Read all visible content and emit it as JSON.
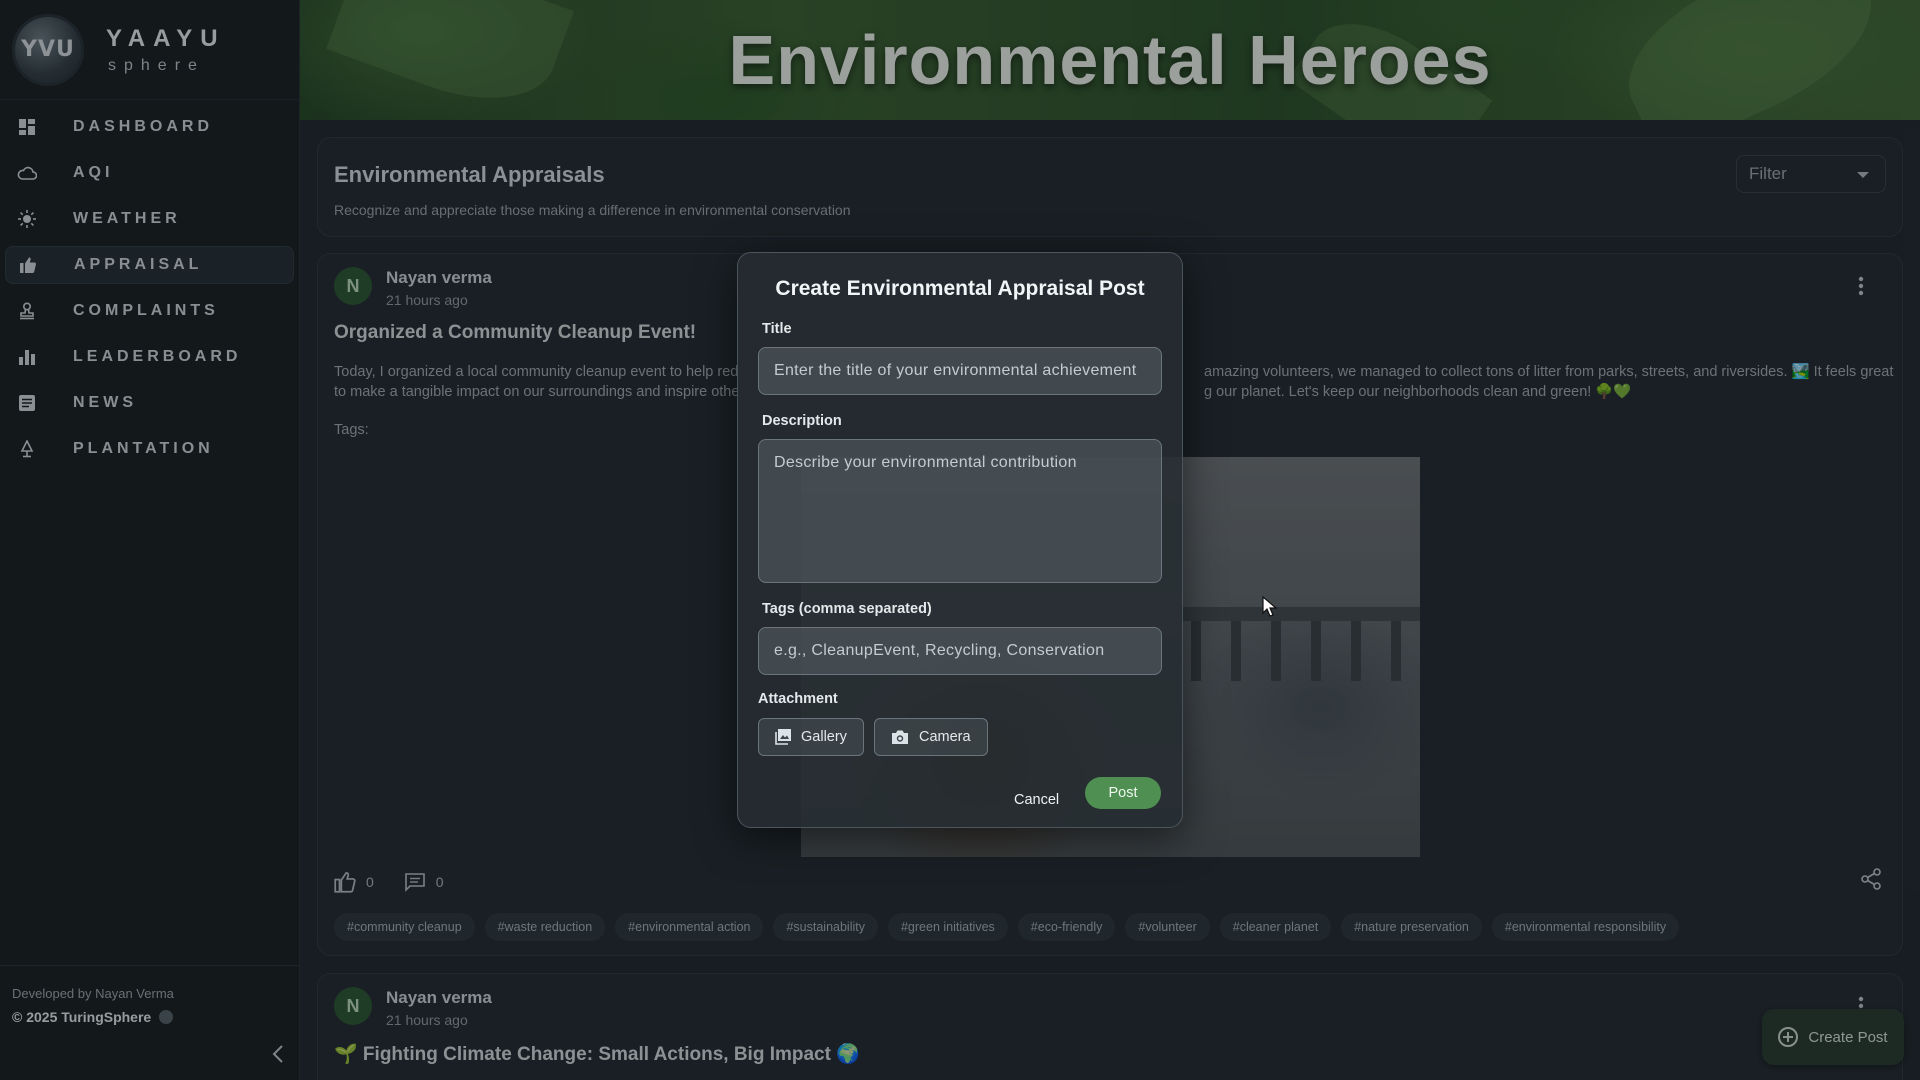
{
  "brand": {
    "logo_text": "YVU",
    "title": "YAAYU",
    "subtitle": "sphere"
  },
  "nav": [
    {
      "label": "DASHBOARD",
      "icon": "dashboard-icon"
    },
    {
      "label": "AQI",
      "icon": "cloud-icon"
    },
    {
      "label": "WEATHER",
      "icon": "sun-icon"
    },
    {
      "label": "APPRAISAL",
      "icon": "thumbs-up-icon",
      "active": true
    },
    {
      "label": "COMPLAINTS",
      "icon": "stamp-icon"
    },
    {
      "label": "LEADERBOARD",
      "icon": "bar-chart-icon"
    },
    {
      "label": "NEWS",
      "icon": "news-icon"
    },
    {
      "label": "PLANTATION",
      "icon": "plant-icon"
    }
  ],
  "footer": {
    "developed_by": "Developed by Nayan Verma",
    "copyright": "© 2025 TuringSphere"
  },
  "hero": {
    "title": "Environmental Heroes"
  },
  "appraisals": {
    "title": "Environmental Appraisals",
    "subtitle": "Recognize and appreciate those making a difference in environmental conservation",
    "filter_label": "Filter"
  },
  "post1": {
    "avatar_letter": "N",
    "author": "Nayan verma",
    "time": "21 hours ago",
    "title": "Organized a Community Cleanup Event!",
    "body_left": "Today, I organized a local community cleanup event to help red",
    "body_left2": "to make a tangible impact on our surroundings and inspire othe",
    "body_right": "amazing volunteers, we managed to collect tons of litter from parks, streets, and riversides. 🏞️ It feels great",
    "body_right2": "g our planet. Let's keep our neighborhoods clean and green! 🌳💚",
    "tags_label": "Tags:",
    "likes": "0",
    "comments": "0",
    "chips": [
      "#community cleanup",
      "#waste reduction",
      "#environmental action",
      "#sustainability",
      "#green initiatives",
      "#eco-friendly",
      "#volunteer",
      "#cleaner planet",
      "#nature preservation",
      "#environmental responsibility"
    ]
  },
  "post2": {
    "avatar_letter": "N",
    "author": "Nayan verma",
    "time": "21 hours ago",
    "title": "🌱 Fighting Climate Change: Small Actions, Big Impact 🌍"
  },
  "fab": {
    "label": "Create Post"
  },
  "modal": {
    "title": "Create Environmental Appraisal Post",
    "title_label": "Title",
    "title_placeholder": "Enter the title of your environmental achievement",
    "description_label": "Description",
    "description_placeholder": "Describe your environmental contribution",
    "tags_label": "Tags (comma separated)",
    "tags_placeholder": "e.g., CleanupEvent, Recycling, Conservation",
    "attachment_label": "Attachment",
    "gallery_label": "Gallery",
    "camera_label": "Camera",
    "cancel_label": "Cancel",
    "post_label": "Post"
  },
  "colors": {
    "accent_green": "#4f8f52",
    "sidebar_bg": "#1c2429",
    "card_bg": "#262f36"
  }
}
